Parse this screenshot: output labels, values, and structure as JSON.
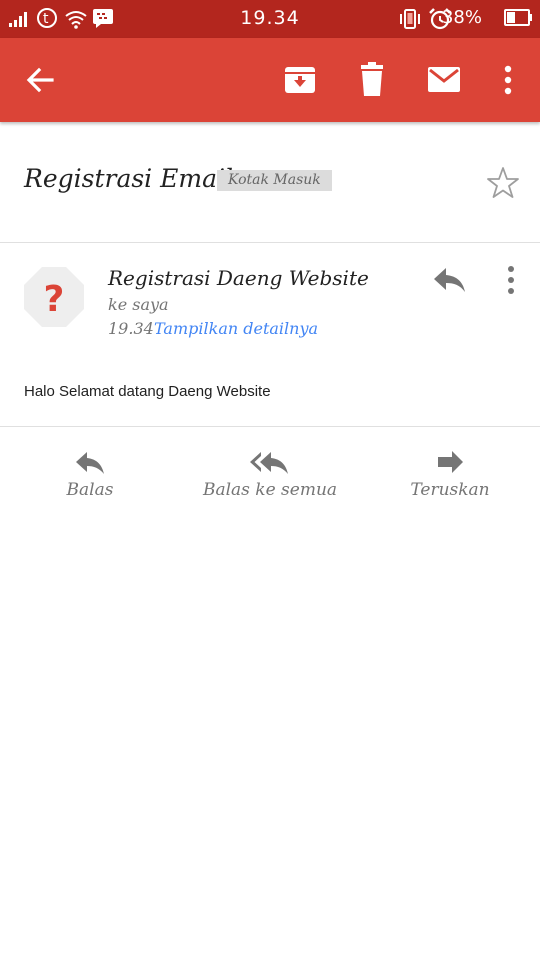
{
  "status_bar": {
    "time": "19.34",
    "battery_percent": "38%"
  },
  "toolbar": {
    "icons": [
      "back-arrow-icon",
      "archive-icon",
      "delete-icon",
      "mark-unread-icon",
      "more-vert-icon"
    ]
  },
  "email": {
    "subject": "Registrasi Email",
    "label": "Kotak Masuk",
    "sender_name": "Registrasi Daeng Website",
    "recipients": "ke saya",
    "time": "19.34",
    "details_link": "Tampilkan detailnya",
    "avatar_glyph": "?",
    "body": "Halo Selamat datang Daeng Website"
  },
  "actions": {
    "reply": "Balas",
    "reply_all": "Balas ke semua",
    "forward": "Teruskan"
  },
  "colors": {
    "status_bar": "#b3261e",
    "toolbar": "#db4437",
    "link": "#4285f4",
    "avatar_bg": "#eeeeee",
    "avatar_glyph": "#db4437"
  }
}
